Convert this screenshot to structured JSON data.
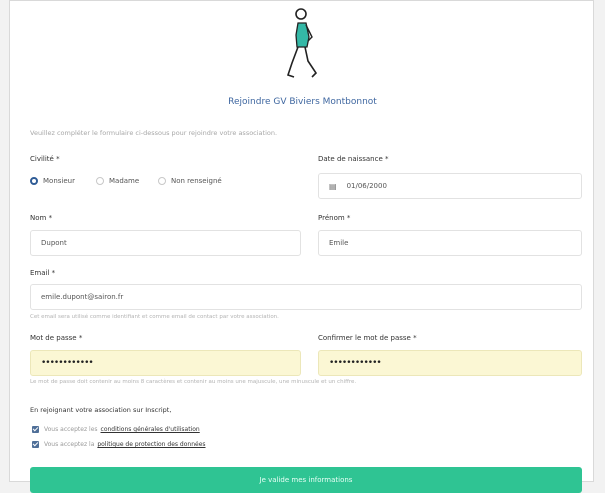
{
  "page": {
    "title": "Rejoindre GV Biviers Montbonnot",
    "intro": "Veuillez compléter le formulaire ci-dessous pour rejoindre votre association."
  },
  "civility": {
    "label": "Civilité *",
    "options": [
      "Monsieur",
      "Madame",
      "Non renseigné"
    ],
    "selected": "Monsieur"
  },
  "birthdate": {
    "label": "Date de naissance *",
    "value": "01/06/2000"
  },
  "lastname": {
    "label": "Nom *",
    "value": "Dupont"
  },
  "firstname": {
    "label": "Prénom *",
    "value": "Emile"
  },
  "email": {
    "label": "Email *",
    "value": "emile.dupont@sairon.fr",
    "help": "Cet email sera utilisé comme identifiant et comme email de contact par votre association."
  },
  "password": {
    "label": "Mot de passe *",
    "value": "••••••••••••"
  },
  "confirm_password": {
    "label": "Confirmer le mot de passe *",
    "value": "••••••••••••"
  },
  "password_help": "Le mot de passe doit contenir au moins 8 caractères et contenir au moins une majuscule, une minuscule et un chiffre.",
  "consent": {
    "heading": "En rejoignant votre association sur Inscript,",
    "items": [
      {
        "text": "Vous acceptez les",
        "link": "conditions générales d'utilisation"
      },
      {
        "text": "Vous acceptez la",
        "link": "politique de protection des données"
      }
    ]
  },
  "submit_label": "Je valide mes informations"
}
